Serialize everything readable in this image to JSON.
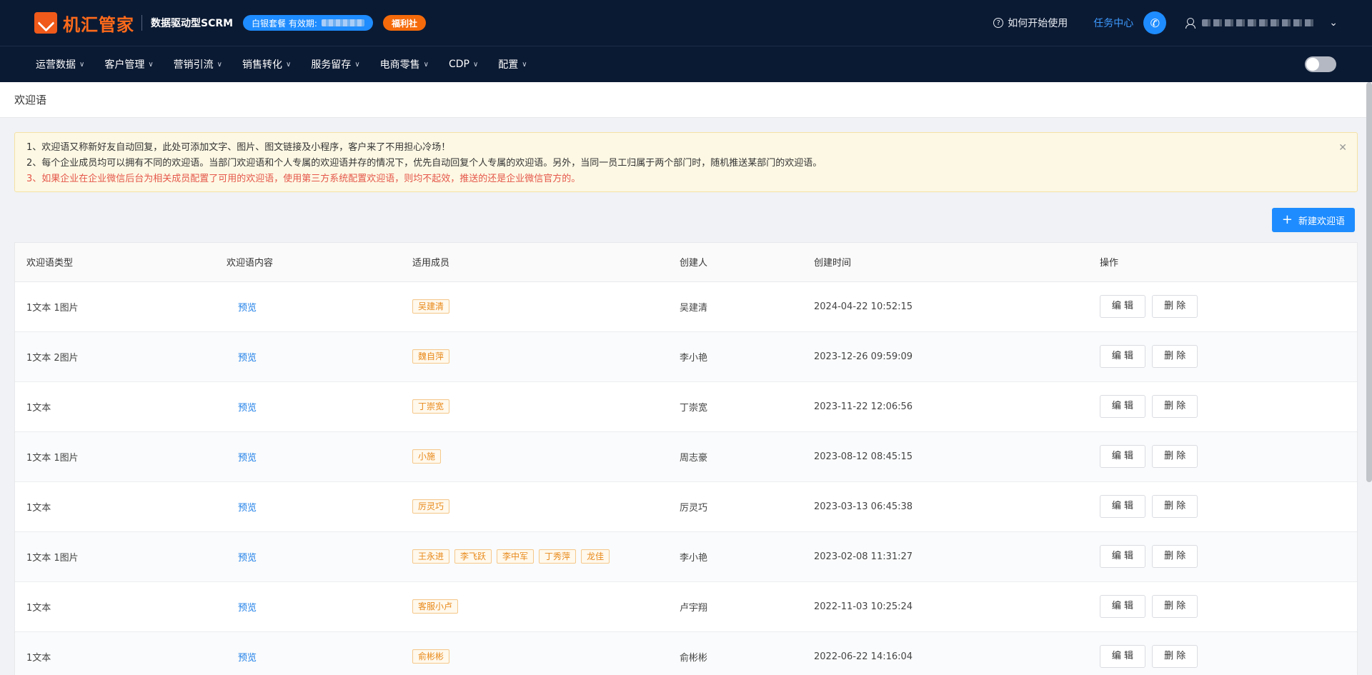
{
  "header": {
    "logo_text": "机汇管家",
    "subtitle": "数据驱动型SCRM",
    "package_label": "白银套餐 有效期:",
    "welfare_label": "福利社",
    "help_label": "如何开始使用",
    "task_center_label": "任务中心"
  },
  "nav": {
    "items": [
      {
        "label": "运营数据"
      },
      {
        "label": "客户管理"
      },
      {
        "label": "营销引流"
      },
      {
        "label": "销售转化"
      },
      {
        "label": "服务留存"
      },
      {
        "label": "电商零售"
      },
      {
        "label": "CDP"
      },
      {
        "label": "配置"
      }
    ]
  },
  "page": {
    "title": "欢迎语"
  },
  "notice": {
    "line1": "1、欢迎语又称新好友自动回复，此处可添加文字、图片、图文链接及小程序，客户来了不用担心冷场！",
    "line2": "2、每个企业成员均可以拥有不同的欢迎语。当部门欢迎语和个人专属的欢迎语并存的情况下，优先自动回复个人专属的欢迎语。另外，当同一员工归属于两个部门时，随机推送某部门的欢迎语。",
    "line3": "3、如果企业在企业微信后台为相关成员配置了可用的欢迎语，使用第三方系统配置欢迎语，则均不起效，推送的还是企业微信官方的。"
  },
  "toolbar": {
    "new_label": "新建欢迎语"
  },
  "table": {
    "headers": {
      "type": "欢迎语类型",
      "content": "欢迎语内容",
      "members": "适用成员",
      "creator": "创建人",
      "created_at": "创建时间",
      "actions": "操作"
    },
    "preview_label": "预览",
    "edit_label": "编 辑",
    "delete_label": "删 除",
    "rows": [
      {
        "type": "1文本 1图片",
        "members": [
          "吴建清"
        ],
        "creator": "吴建清",
        "time": "2024-04-22 10:52:15"
      },
      {
        "type": "1文本 2图片",
        "members": [
          "魏自萍"
        ],
        "creator": "李小艳",
        "time": "2023-12-26 09:59:09"
      },
      {
        "type": "1文本",
        "members": [
          "丁崇宽"
        ],
        "creator": "丁崇宽",
        "time": "2023-11-22 12:06:56"
      },
      {
        "type": "1文本 1图片",
        "members": [
          "小施"
        ],
        "creator": "周志豪",
        "time": "2023-08-12 08:45:15"
      },
      {
        "type": "1文本",
        "members": [
          "厉灵巧"
        ],
        "creator": "厉灵巧",
        "time": "2023-03-13 06:45:38"
      },
      {
        "type": "1文本 1图片",
        "members": [
          "王永进",
          "李飞跃",
          "李中军",
          "丁秀萍",
          "龙佳"
        ],
        "creator": "李小艳",
        "time": "2023-02-08 11:31:27"
      },
      {
        "type": "1文本",
        "members": [
          "客服小卢"
        ],
        "creator": "卢宇翔",
        "time": "2022-11-03 10:25:24"
      },
      {
        "type": "1文本",
        "members": [
          "俞彬彬"
        ],
        "creator": "俞彬彬",
        "time": "2022-06-22 14:16:04"
      }
    ]
  }
}
